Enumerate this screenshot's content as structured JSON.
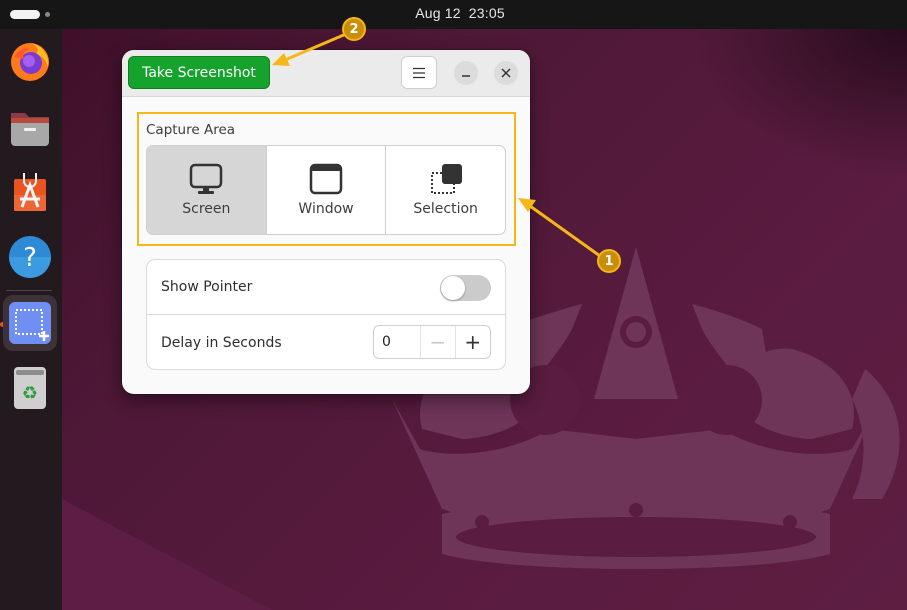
{
  "topbar": {
    "date": "Aug 12",
    "time": "23:05"
  },
  "dock": {
    "items": [
      {
        "name": "Firefox",
        "icon": "firefox-icon"
      },
      {
        "name": "Files",
        "icon": "files-icon"
      },
      {
        "name": "App Center",
        "icon": "app-center-icon"
      },
      {
        "name": "Help",
        "icon": "help-icon"
      },
      {
        "name": "Screenshot",
        "icon": "screenshot-icon",
        "active": true
      },
      {
        "name": "Trash",
        "icon": "trash-icon"
      }
    ]
  },
  "window": {
    "take_screenshot_label": "Take Screenshot",
    "menu_icon": "hamburger-menu-icon",
    "minimize_icon": "minimize-icon",
    "close_icon": "close-icon",
    "capture_area": {
      "label": "Capture Area",
      "options": [
        {
          "label": "Screen",
          "icon": "monitor-icon",
          "selected": true
        },
        {
          "label": "Window",
          "icon": "window-icon",
          "selected": false
        },
        {
          "label": "Selection",
          "icon": "selection-icon",
          "selected": false
        }
      ]
    },
    "show_pointer": {
      "label": "Show Pointer",
      "enabled": false
    },
    "delay": {
      "label": "Delay in Seconds",
      "value": "0",
      "minus_label": "−",
      "plus_label": "+"
    }
  },
  "annotations": {
    "badge1": "1",
    "badge2": "2",
    "color": "#f6b817"
  }
}
